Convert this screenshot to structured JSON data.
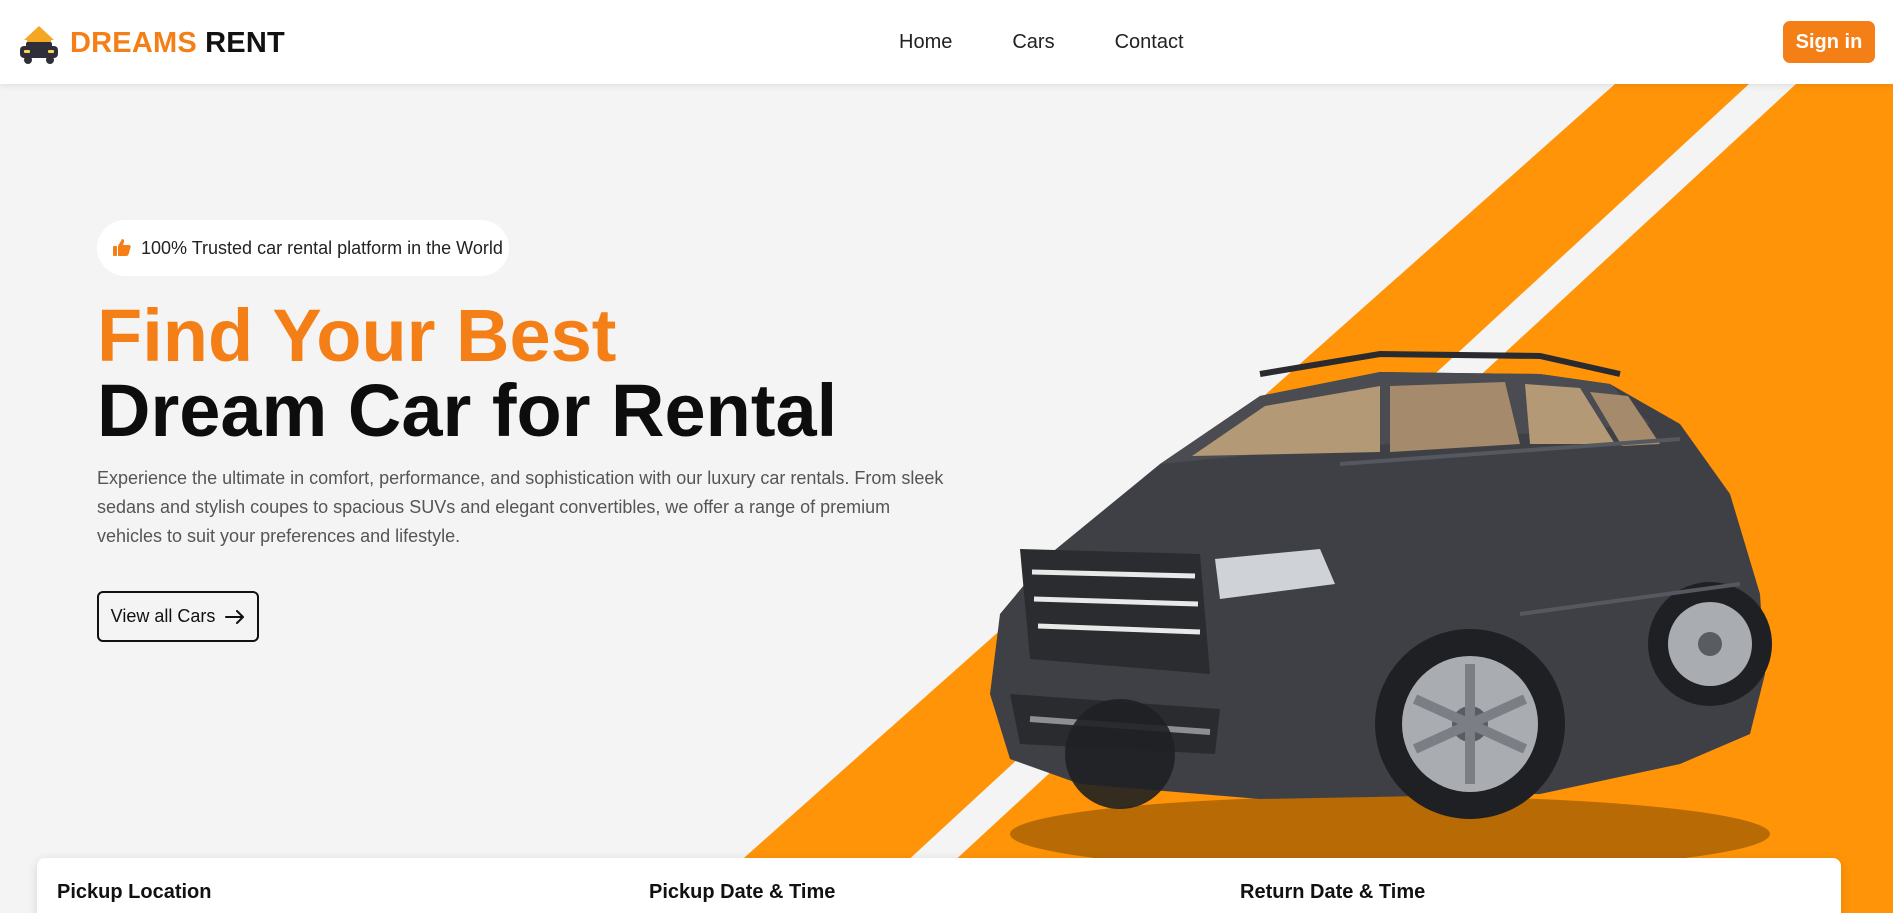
{
  "brand": {
    "part1": "DREAMS",
    "part2": "RENT",
    "icon": "car-house-icon"
  },
  "nav": {
    "items": [
      "Home",
      "Cars",
      "Contact"
    ],
    "signin_label": "Sign in"
  },
  "hero": {
    "badge_text": "100% Trusted car rental platform in the World",
    "badge_icon": "thumbs-up-icon",
    "title_line1": "Find Your Best",
    "title_line2": "Dream Car for Rental",
    "description": "Experience the ultimate in comfort, performance, and sophistication with our luxury car rentals. From sleek sedans and stylish coupes to spacious SUVs and elegant convertibles, we offer a range of premium vehicles to suit your preferences and lifestyle.",
    "cta_label": "View all Cars",
    "cta_icon": "arrow-right-icon",
    "image": "suv-car-image"
  },
  "booking": {
    "fields": [
      "Pickup Location",
      "Pickup Date & Time",
      "Return Date & Time"
    ]
  },
  "colors": {
    "accent": "#f57f17",
    "stripe": "#ff9408",
    "background": "#f3f4f3"
  }
}
